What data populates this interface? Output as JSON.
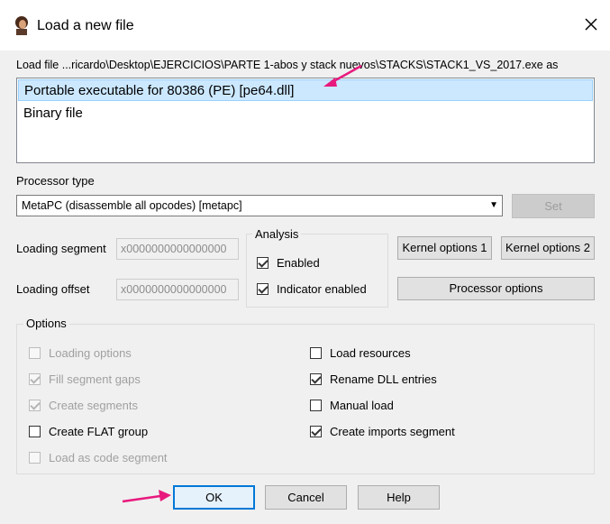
{
  "window": {
    "title": "Load a new file",
    "close_label": "✕"
  },
  "load_file": {
    "label": "Load file ...ricardo\\Desktop\\EJERCICIOS\\PARTE 1-abos y stack nuevos\\STACKS\\STACK1_VS_2017.exe as",
    "items": [
      {
        "label": "Portable executable for 80386 (PE) [pe64.dll]",
        "selected": true
      },
      {
        "label": "Binary file",
        "selected": false
      }
    ]
  },
  "processor": {
    "label": "Processor type",
    "selected": "MetaPC (disassemble all opcodes) [metapc]",
    "set_label": "Set"
  },
  "loading": {
    "segment_label": "Loading segment",
    "segment_value": "x0000000000000000",
    "offset_label": "Loading offset",
    "offset_value": "x0000000000000000"
  },
  "analysis": {
    "title": "Analysis",
    "enabled_label": "Enabled",
    "enabled": true,
    "indicator_label": "Indicator enabled",
    "indicator": true
  },
  "buttons": {
    "kernel1": "Kernel options 1",
    "kernel2": "Kernel options 2",
    "processor_options": "Processor options",
    "ok": "OK",
    "cancel": "Cancel",
    "help": "Help"
  },
  "options": {
    "title": "Options",
    "left": [
      {
        "label": "Loading options",
        "checked": false,
        "disabled": true
      },
      {
        "label": "Fill segment gaps",
        "checked": true,
        "disabled": true
      },
      {
        "label": "Create segments",
        "checked": true,
        "disabled": true
      },
      {
        "label": "Create FLAT group",
        "checked": false,
        "disabled": false
      },
      {
        "label": "Load as code segment",
        "checked": false,
        "disabled": true
      }
    ],
    "right": [
      {
        "label": "Load resources",
        "checked": false,
        "disabled": false
      },
      {
        "label": "Rename DLL entries",
        "checked": true,
        "disabled": false
      },
      {
        "label": "Manual load",
        "checked": false,
        "disabled": false
      },
      {
        "label": "Create imports segment",
        "checked": true,
        "disabled": false
      }
    ]
  },
  "colors": {
    "annotation_arrow": "#e8197d",
    "selection": "#cce8ff",
    "default_button_border": "#0078d7"
  }
}
